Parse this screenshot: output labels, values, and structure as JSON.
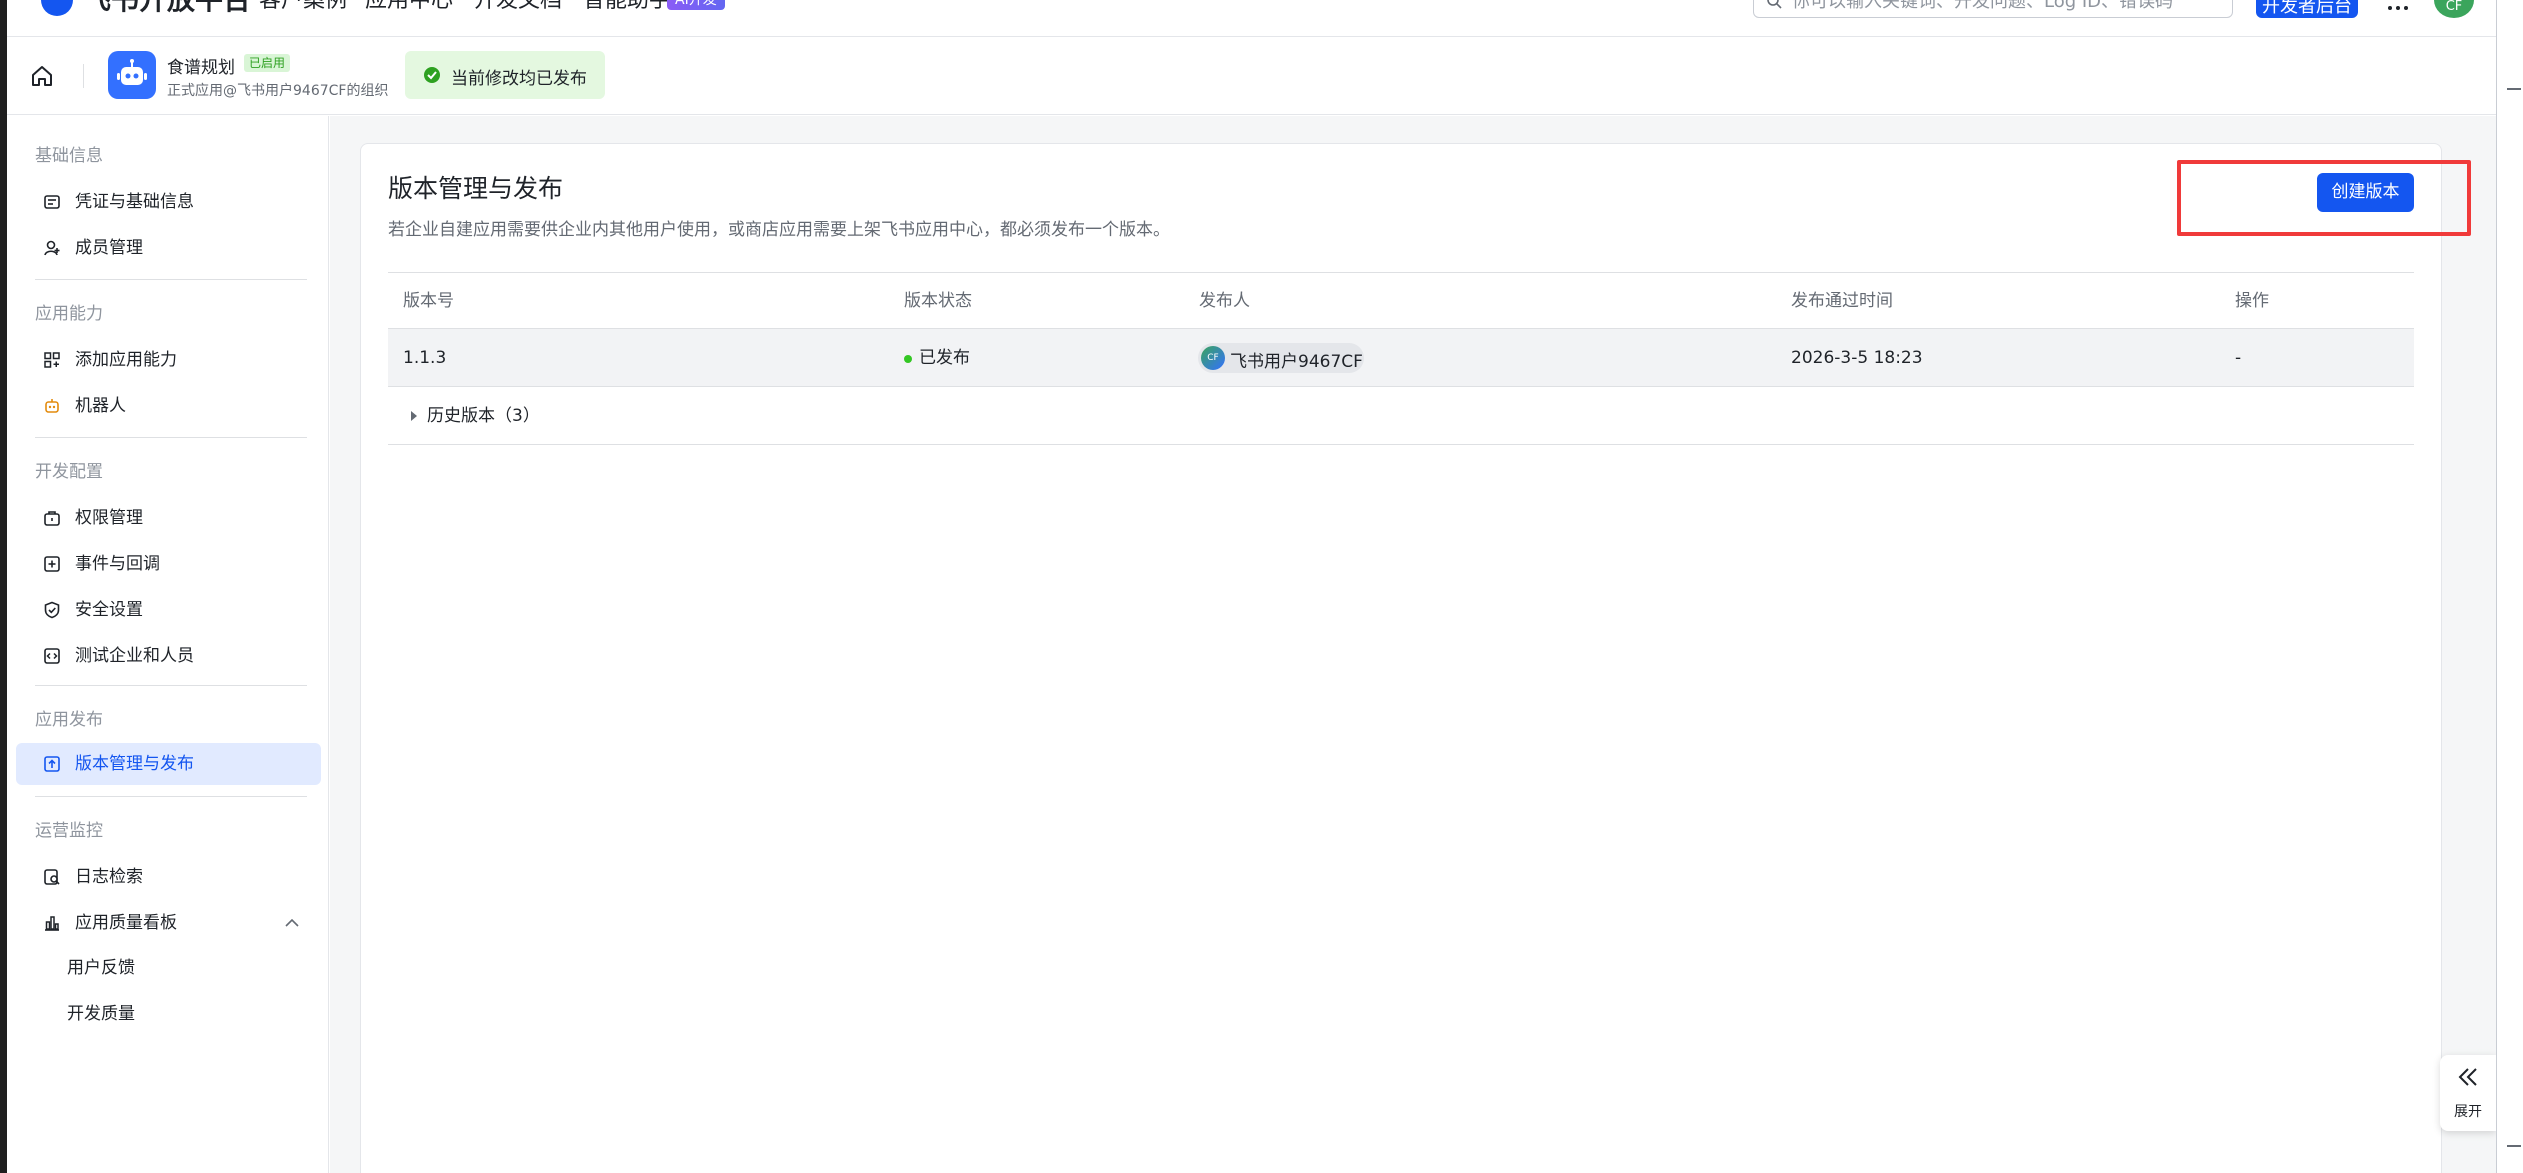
{
  "topnav": {
    "brand": "飞书开放平台",
    "items": [
      "客户案例",
      "应用中心",
      "开发文档",
      "智能助手"
    ],
    "ai_badge": "AI开发",
    "search_placeholder": "你可以输入关键词、开发问题、Log ID、错误码",
    "console_button": "开发者后台",
    "avatar_text": "CF"
  },
  "appbar": {
    "app_name": "食谱规划",
    "app_tag": "已启用",
    "app_subtitle": "正式应用@飞书用户9467CF的组织",
    "status_text": "当前修改均已发布"
  },
  "sidebar": {
    "sections": [
      {
        "title": "基础信息",
        "items": [
          "凭证与基础信息",
          "成员管理"
        ]
      },
      {
        "title": "应用能力",
        "items": [
          "添加应用能力",
          "机器人"
        ]
      },
      {
        "title": "开发配置",
        "items": [
          "权限管理",
          "事件与回调",
          "安全设置",
          "测试企业和人员"
        ]
      },
      {
        "title": "应用发布",
        "items": [
          "版本管理与发布"
        ]
      },
      {
        "title": "运营监控",
        "items": [
          "日志检索",
          "应用质量看板"
        ]
      }
    ],
    "sub_items": [
      "用户反馈",
      "开发质量"
    ],
    "active_item": "版本管理与发布"
  },
  "main": {
    "title": "版本管理与发布",
    "description": "若企业自建应用需要供企业内其他用户使用，或商店应用需要上架飞书应用中心，都必须发布一个版本。",
    "create_button": "创建版本",
    "table": {
      "headers": [
        "版本号",
        "版本状态",
        "发布人",
        "发布通过时间",
        "操作"
      ],
      "rows": [
        {
          "version": "1.1.3",
          "status": "已发布",
          "publisher": "飞书用户9467CF",
          "publisher_avatar": "CF",
          "time": "2026-3-5 18:23",
          "action": "-"
        }
      ],
      "history_label": "历史版本（3）"
    },
    "expand_label": "展开"
  },
  "colors": {
    "accent": "#1456f0",
    "status_published": "#34c724",
    "highlight_border": "#f03a3a",
    "status_pill_bg": "#e4f8e0"
  }
}
